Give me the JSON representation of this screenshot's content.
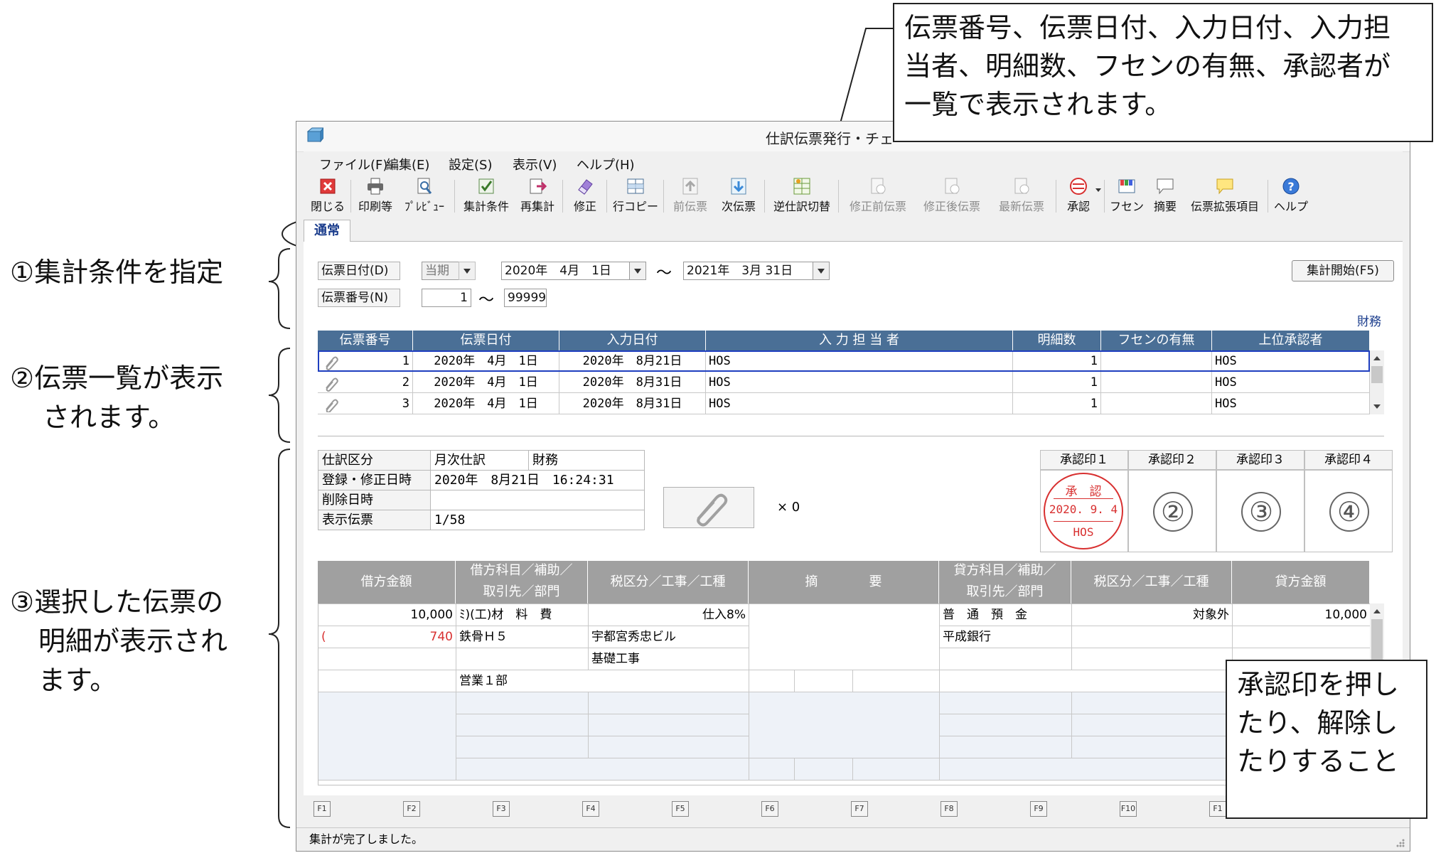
{
  "annotations": {
    "left_1": "①集計条件を指定",
    "left_2_line1": "②伝票一覧が表示",
    "left_2_line2": "されます。",
    "left_3_line1": "③選択した伝票の",
    "left_3_line2": "明細が表示され",
    "left_3_line3": "ます。",
    "callout_top": [
      "伝票番号、伝票日付、入力日付、入力担",
      "当者、明細数、フセンの有無、承認者が",
      "一覧で表示されます。"
    ],
    "callout_right": [
      "承認印を押し",
      "たり、解除し",
      "たりすること"
    ]
  },
  "window": {
    "title": "仕訳伝票発行・チェ",
    "menu": [
      "ファイル(F)",
      "編集(E)",
      "設定(S)",
      "表示(V)",
      "ヘルプ(H)"
    ],
    "toolbar": [
      {
        "label": "閉じる",
        "icon": "close-icon"
      },
      {
        "label": "印刷等",
        "icon": "printer-icon"
      },
      {
        "label": "ﾌﾟﾚﾋﾞｭｰ",
        "icon": "preview-icon"
      },
      {
        "label": "集計条件",
        "icon": "conditions-icon"
      },
      {
        "label": "再集計",
        "icon": "recalc-icon"
      },
      {
        "label": "修正",
        "icon": "eraser-icon"
      },
      {
        "label": "行コピー",
        "icon": "row-copy-icon"
      },
      {
        "label": "前伝票",
        "icon": "prev-slip-icon"
      },
      {
        "label": "次伝票",
        "icon": "next-slip-icon"
      },
      {
        "label": "逆仕訳切替",
        "icon": "reverse-icon"
      },
      {
        "label": "修正前伝票",
        "icon": "before-edit-icon"
      },
      {
        "label": "修正後伝票",
        "icon": "after-edit-icon"
      },
      {
        "label": "最新伝票",
        "icon": "latest-icon"
      },
      {
        "label": "承認",
        "icon": "approve-icon"
      },
      {
        "label": "フセン",
        "icon": "sticky-icon"
      },
      {
        "label": "摘要",
        "icon": "memo-icon"
      },
      {
        "label": "伝票拡張項目",
        "icon": "extend-icon"
      },
      {
        "label": "ヘルプ",
        "icon": "help-icon"
      }
    ],
    "tab": "通常",
    "filter": {
      "date_label": "伝票日付(D)",
      "period": "当期",
      "date_from": "2020年　4月　1日",
      "tilde": "～",
      "date_to": "2021年　3月 31日",
      "number_label": "伝票番号(N)",
      "number_from": "1",
      "number_to": "99999",
      "start_button": "集計開始(F5)",
      "category": "財務"
    },
    "list": {
      "headers": [
        "伝票番号",
        "伝票日付",
        "入力日付",
        "入 力 担 当 者",
        "明細数",
        "フセンの有無",
        "上位承認者"
      ],
      "rows": [
        [
          "1",
          "2020年　4月　1日",
          "2020年　8月21日",
          "HOS",
          "1",
          "",
          "HOS"
        ],
        [
          "2",
          "2020年　4月　1日",
          "2020年　8月31日",
          "HOS",
          "1",
          "",
          "HOS"
        ],
        [
          "3",
          "2020年　4月　1日",
          "2020年　8月31日",
          "HOS",
          "1",
          "",
          "HOS"
        ]
      ]
    },
    "detail": {
      "kubun_label": "仕訳区分",
      "kubun_value": "月次仕訳",
      "kubun_value2": "財務",
      "reg_label": "登録・修正日時",
      "reg_value": "2020年　8月21日　16:24:31",
      "del_label": "削除日時",
      "del_value": "",
      "show_label": "表示伝票",
      "show_value": "1/58",
      "attach_count": "× 0",
      "stamp_headers": [
        "承認印１",
        "承認印２",
        "承認印３",
        "承認印４"
      ],
      "stamp1": {
        "top": "承　認",
        "date": "2020. 9. 4",
        "name": "HOS"
      },
      "stamp_nums": [
        "②",
        "③",
        "④"
      ]
    },
    "journal": {
      "headers": {
        "debit_amount": "借方金額",
        "debit_account_1": "借方科目／補助／",
        "debit_account_2": "取引先／部門",
        "tax1": "税区分／工事／工種",
        "memo": "摘　　　　要",
        "credit_account_1": "貸方科目／補助／",
        "credit_account_2": "取引先／部門",
        "tax2": "税区分／工事／工種",
        "credit_amount": "貸方金額"
      },
      "debit_amount": "10,000",
      "debit_tax_paren": "(",
      "debit_tax_amount": "740",
      "debit_account": "ﾐ)(工)材　料　費",
      "debit_sub": "鉄骨Ｈ５",
      "debit_dept": "営業１部",
      "tax1_value": "仕入8%",
      "site": "宇都宮秀忠ビル",
      "work": "基礎工事",
      "credit_account": "普　通　預　金",
      "credit_sub": "平成銀行",
      "tax2_value": "対象外",
      "credit_amount": "10,000"
    },
    "fkeys": [
      "F1",
      "F2",
      "F3",
      "F4",
      "F5",
      "F6",
      "F7",
      "F8",
      "F9",
      "F10",
      "F1"
    ],
    "status": "集計が完了しました。"
  },
  "colors": {
    "grid_header": "#4a6f96",
    "stamp_red": "#d83030",
    "selection": "#1f3fbf"
  }
}
